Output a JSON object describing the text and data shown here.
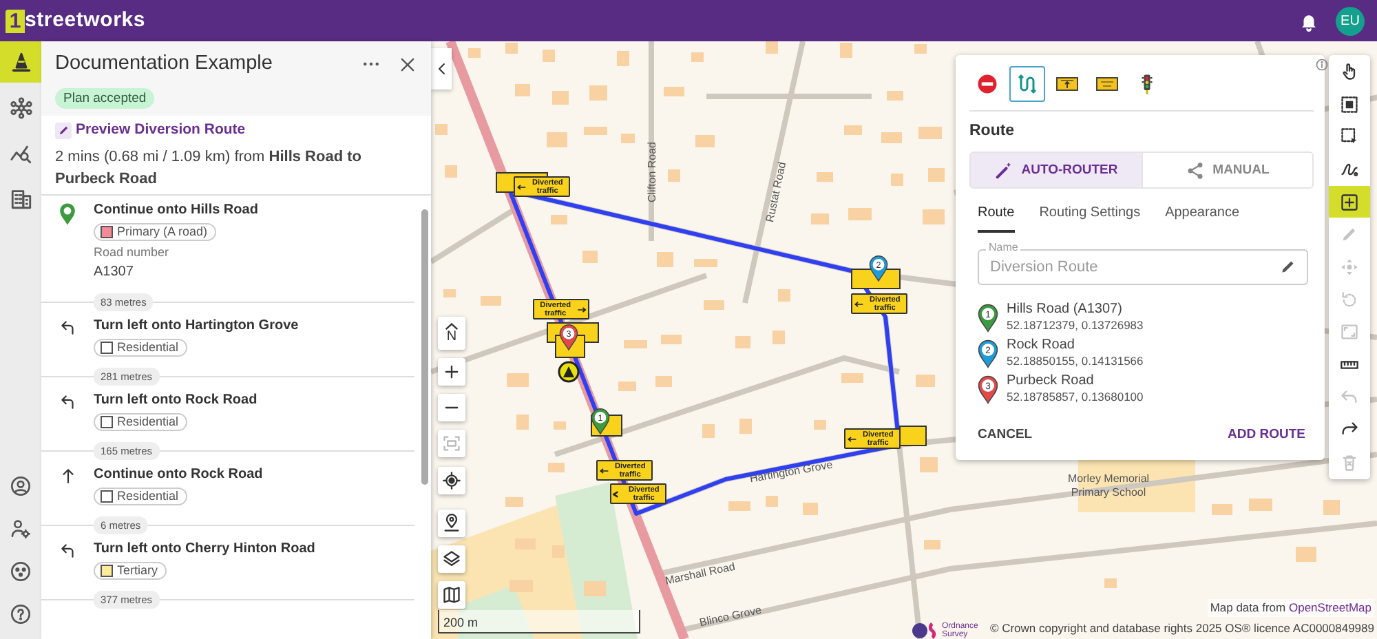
{
  "app_bar": {
    "logo_mark": "1",
    "logo_text": "streetworks",
    "avatar": "EU"
  },
  "rail": {
    "top": [
      {
        "selected": true
      },
      {
        "selected": false
      },
      {
        "selected": false
      },
      {
        "selected": false
      }
    ],
    "bottom": [
      {
        "selected": false
      },
      {
        "selected": false
      },
      {
        "selected": false
      },
      {
        "selected": false
      }
    ]
  },
  "panel": {
    "title": "Documentation Example",
    "status": "Plan accepted",
    "preview_link": "Preview Diversion Route",
    "summary": "2 mins (0.68 mi / 1.09 km) from **Hills Road to Purbeck Road**",
    "steps": [
      {
        "kind": "start",
        "instruction": "Continue onto Hills Road",
        "road_type": "Primary (A road)",
        "color": "#f48a97",
        "road_number_label": "Road number",
        "road_number": "A1307",
        "distance": "83 metres"
      },
      {
        "kind": "left",
        "instruction": "Turn left onto Hartington Grove",
        "road_type": "Residential",
        "color": "#ffffff",
        "distance": "281 metres"
      },
      {
        "kind": "left",
        "instruction": "Turn left onto Rock Road",
        "road_type": "Residential",
        "color": "#ffffff",
        "distance": "165 metres"
      },
      {
        "kind": "straight",
        "instruction": "Continue onto Rock Road",
        "road_type": "Residential",
        "color": "#ffffff",
        "distance": "6 metres"
      },
      {
        "kind": "left",
        "instruction": "Turn left onto Cherry Hinton Road",
        "road_type": "Tertiary",
        "color": "#fdeb9c",
        "distance": "377 metres"
      }
    ]
  },
  "map": {
    "compass": "N",
    "controls": [
      {
        "disabled": false
      },
      {
        "disabled": false
      },
      {
        "disabled": true
      },
      {
        "disabled": false
      },
      {
        "disabled": false
      },
      {
        "disabled": false
      },
      {
        "disabled": false
      }
    ],
    "labels": [
      "Clifton Road",
      "Rustat Road",
      "Hartington Grove",
      "Marshall Road",
      "Blinco Grove",
      "Morley Memorial",
      "Primary School"
    ],
    "signs": [
      {
        "text": "Diverted traffic",
        "kind": "left"
      },
      {
        "text": "Diverted traffic",
        "kind": "right"
      },
      {
        "text": "Diverted traffic",
        "kind": "left"
      },
      {
        "text": "Diverted traffic",
        "kind": "left"
      },
      {
        "text": "Diverted traffic",
        "kind": "left"
      },
      {
        "text": "Diverted traffic",
        "kind": "chevron"
      }
    ],
    "pins": [
      {
        "number": "1",
        "color": "#3c9a3f"
      },
      {
        "number": "2",
        "color": "#1f9bd7"
      },
      {
        "number": "3",
        "color": "#e14a4a"
      }
    ],
    "scale": "200 m",
    "os_logo": "Ordnance Survey",
    "osm_prefix": "Map data from ",
    "osm_link": "OpenStreetMap",
    "copyright": "© Crown copyright and database rights 2025 OS® licence AC0000849989"
  },
  "route_panel": {
    "tools": [
      {
        "selected": false
      },
      {
        "selected": true
      },
      {
        "selected": false
      },
      {
        "selected": false
      },
      {
        "selected": false
      }
    ],
    "heading": "Route",
    "modes": [
      {
        "label": "AUTO-ROUTER",
        "selected": true
      },
      {
        "label": "MANUAL",
        "selected": false
      }
    ],
    "tabs": [
      {
        "label": "Route",
        "selected": true
      },
      {
        "label": "Routing Settings",
        "selected": false
      },
      {
        "label": "Appearance",
        "selected": false
      }
    ],
    "name_field": {
      "label": "Name",
      "value": "Diversion Route"
    },
    "waypoints": [
      {
        "number": "1",
        "color": "#3c9a3f",
        "name": "Hills Road (A1307)",
        "coords": "52.18712379, 0.13726983"
      },
      {
        "number": "2",
        "color": "#1f9bd7",
        "name": "Rock Road",
        "coords": "52.18850155, 0.14131566"
      },
      {
        "number": "3",
        "color": "#e14a4a",
        "name": "Purbeck Road",
        "coords": "52.18785857, 0.13680100"
      }
    ],
    "cancel": "CANCEL",
    "submit": "ADD ROUTE"
  },
  "map_tools": [
    {
      "active": false,
      "disabled": false
    },
    {
      "active": false,
      "disabled": false
    },
    {
      "active": false,
      "disabled": false
    },
    {
      "active": false,
      "disabled": false
    },
    {
      "active": true,
      "disabled": false
    },
    {
      "active": false,
      "disabled": true
    },
    {
      "active": false,
      "disabled": true
    },
    {
      "active": false,
      "disabled": true
    },
    {
      "active": false,
      "disabled": true
    },
    {
      "active": false,
      "disabled": false
    },
    {
      "active": false,
      "disabled": true
    },
    {
      "active": false,
      "disabled": false
    },
    {
      "active": false,
      "disabled": true
    }
  ]
}
